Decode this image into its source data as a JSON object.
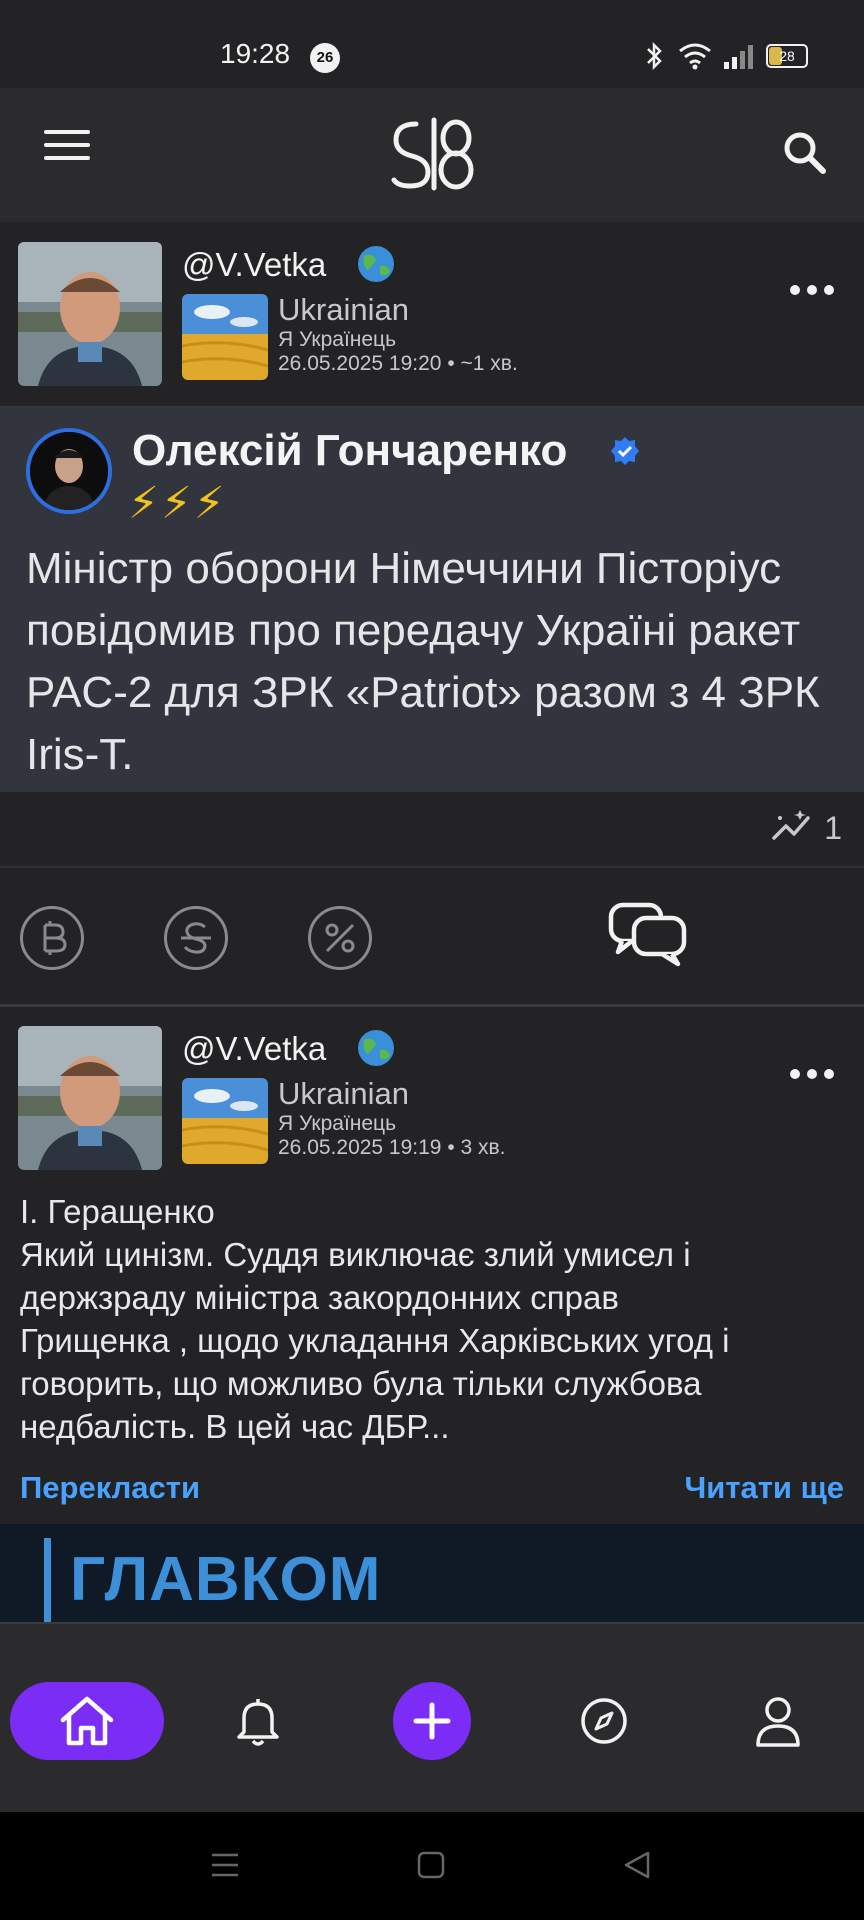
{
  "status_bar": {
    "time": "19:28",
    "notification_count": "26",
    "battery": "28"
  },
  "header": {
    "logo": "SI8"
  },
  "posts": [
    {
      "handle": "@V.Vetka",
      "language": "Ukrainian",
      "community": "Я Українець",
      "timestamp": "26.05.2025 19:20 • ~1 хв.",
      "embed": {
        "author": "Олексій Гончаренко",
        "emoji": "⚡⚡⚡",
        "text": "Міністр оборони Німеччини Пісторіус повідомив про передачу Україні ракет PAC-2 для ЗРК «Patriot» разом з 4 ЗРК Iris-T."
      },
      "stats_count": "1"
    },
    {
      "handle": "@V.Vetka",
      "language": "Ukrainian",
      "community": "Я Українець",
      "timestamp": "26.05.2025 19:19 • 3 хв.",
      "text_lines": [
        "І. Геращенко",
        "Який цинізм. Суддя виключає злий умисел і",
        "держзраду міністра закордонних справ",
        "Грищенка , щодо укладання Харківських угод і",
        "говорить, що можливо була тільки службова",
        "недбалість. В цей час ДБР..."
      ],
      "translate_label": "Перекласти",
      "read_more_label": "Читати ще",
      "link_preview_brand": "ГЛАВКОМ"
    }
  ],
  "action_icons": [
    "bitcoin-coin-icon",
    "strikethrough-coin-icon",
    "percent-coin-icon",
    "comments-icon"
  ],
  "bottom_nav": [
    "home-icon",
    "bell-icon",
    "plus-icon",
    "compass-icon",
    "profile-icon"
  ],
  "colors": {
    "accent": "#7b2cf5",
    "link": "#4aa2ff",
    "background": "#232326",
    "embed_bg": "#32353d"
  }
}
